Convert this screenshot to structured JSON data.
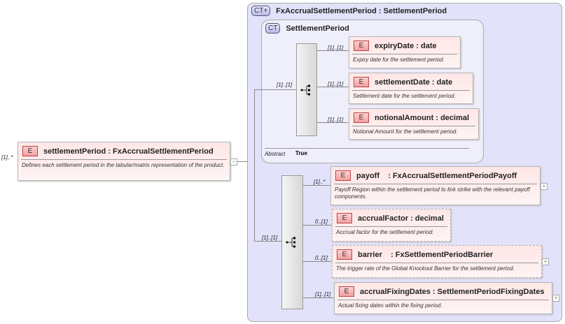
{
  "root": {
    "cardinality": "[1]..*",
    "badge": "E",
    "name": "settlementPeriod : FxAccrualSettlementPeriod",
    "doc": "Defines each settlement period in the tabular/matrix representation of the product.",
    "collapse": "−"
  },
  "complex_type": {
    "badge": "CT+",
    "name": "FxAccrualSettlementPeriod : SettlementPeriod"
  },
  "base_type": {
    "badge": "CT",
    "name": "SettlementPeriod",
    "abstract_label": "Abstract",
    "abstract_value": "True",
    "seq_cardinality": "[1]..[1]",
    "children": [
      {
        "cardinality": "[1]..[1]",
        "badge": "E",
        "name": "expiryDate : date",
        "doc": "Expiry date for the settlement period."
      },
      {
        "cardinality": "[1]..[1]",
        "badge": "E",
        "name": "settlementDate : date",
        "doc": "Settlement date for the settlement period."
      },
      {
        "cardinality": "[1]..[1]",
        "badge": "E",
        "name": "notionalAmount : decimal",
        "doc": "Notional Amount for the settlement period."
      }
    ]
  },
  "extension": {
    "seq_cardinality": "[1]..[1]",
    "children": [
      {
        "cardinality": "[1]..*",
        "badge": "E",
        "name": "payoff    : FxAccrualSettlementPeriodPayoff",
        "doc": "Payoff Region within the settlement period to link strike with the relevant payoff components.",
        "expand": "+"
      },
      {
        "cardinality": "0..[1]",
        "badge": "E",
        "name": "accrualFactor : decimal",
        "doc": "Accrual factor for the settlement period."
      },
      {
        "cardinality": "0..[1]",
        "badge": "E",
        "name": "barrier    : FxSettlementPeriodBarrier",
        "doc": "The trigger rate of the Global Knockout Barrier for the settlement period.",
        "expand": "+"
      },
      {
        "cardinality": "[1]..[1]",
        "badge": "E",
        "name": "accrualFixingDates : SettlementPeriodFixingDates",
        "doc": "Actual fixing dates within the fixing period.",
        "expand": "+"
      }
    ]
  }
}
